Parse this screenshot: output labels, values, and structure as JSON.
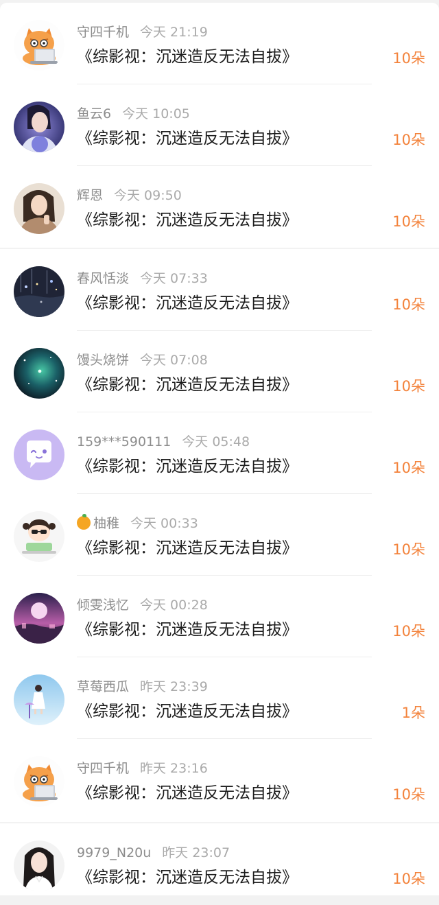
{
  "gift_list": {
    "items": [
      {
        "name": "守四千机",
        "time": "今天 21:19",
        "title": "《综影视：沉迷造反无法自拔》",
        "amount": "10朵",
        "avatar_icon": "cat-avatar-icon",
        "badge_icon": ""
      },
      {
        "name": "鱼云6",
        "time": "今天 10:05",
        "title": "《综影视：沉迷造反无法自拔》",
        "amount": "10朵",
        "avatar_icon": "girl-portrait-avatar-icon",
        "badge_icon": ""
      },
      {
        "name": "辉恩",
        "time": "今天 09:50",
        "title": "《综影视：沉迷造反无法自拔》",
        "amount": "10朵",
        "avatar_icon": "woman-photo-avatar-icon",
        "badge_icon": ""
      },
      {
        "name": "春风恬淡",
        "time": "今天 07:33",
        "title": "《综影视：沉迷造反无法自拔》",
        "amount": "10朵",
        "avatar_icon": "night-scene-avatar-icon",
        "badge_icon": ""
      },
      {
        "name": "馒头烧饼",
        "time": "今天 07:08",
        "title": "《综影视：沉迷造反无法自拔》",
        "amount": "10朵",
        "avatar_icon": "galaxy-avatar-icon",
        "badge_icon": ""
      },
      {
        "name": "159***590111",
        "time": "今天 05:48",
        "title": "《综影视：沉迷造反无法自拔》",
        "amount": "10朵",
        "avatar_icon": "default-chat-avatar-icon",
        "badge_icon": ""
      },
      {
        "name": "柚稚",
        "time": "今天 00:33",
        "title": "《综影视：沉迷造反无法自拔》",
        "amount": "10朵",
        "avatar_icon": "cartoon-girl-avatar-icon",
        "badge_icon": "tangerine-icon"
      },
      {
        "name": "倾雯浅忆",
        "time": "今天 00:28",
        "title": "《综影视：沉迷造反无法自拔》",
        "amount": "10朵",
        "avatar_icon": "pink-moon-avatar-icon",
        "badge_icon": ""
      },
      {
        "name": "草莓西瓜",
        "time": "昨天 23:39",
        "title": "《综影视：沉迷造反无法自拔》",
        "amount": "1朵",
        "avatar_icon": "blue-sky-girl-avatar-icon",
        "badge_icon": ""
      },
      {
        "name": "守四千机",
        "time": "昨天 23:16",
        "title": "《综影视：沉迷造反无法自拔》",
        "amount": "10朵",
        "avatar_icon": "cat-avatar-icon",
        "badge_icon": ""
      },
      {
        "name": "9979_N20u",
        "time": "昨天 23:07",
        "title": "《综影视：沉迷造反无法自拔》",
        "amount": "10朵",
        "avatar_icon": "woman-portrait-avatar-icon",
        "badge_icon": ""
      }
    ]
  },
  "colors": {
    "accent_amount": "#f3833c",
    "background": "#f2f2f2",
    "card": "#ffffff"
  }
}
